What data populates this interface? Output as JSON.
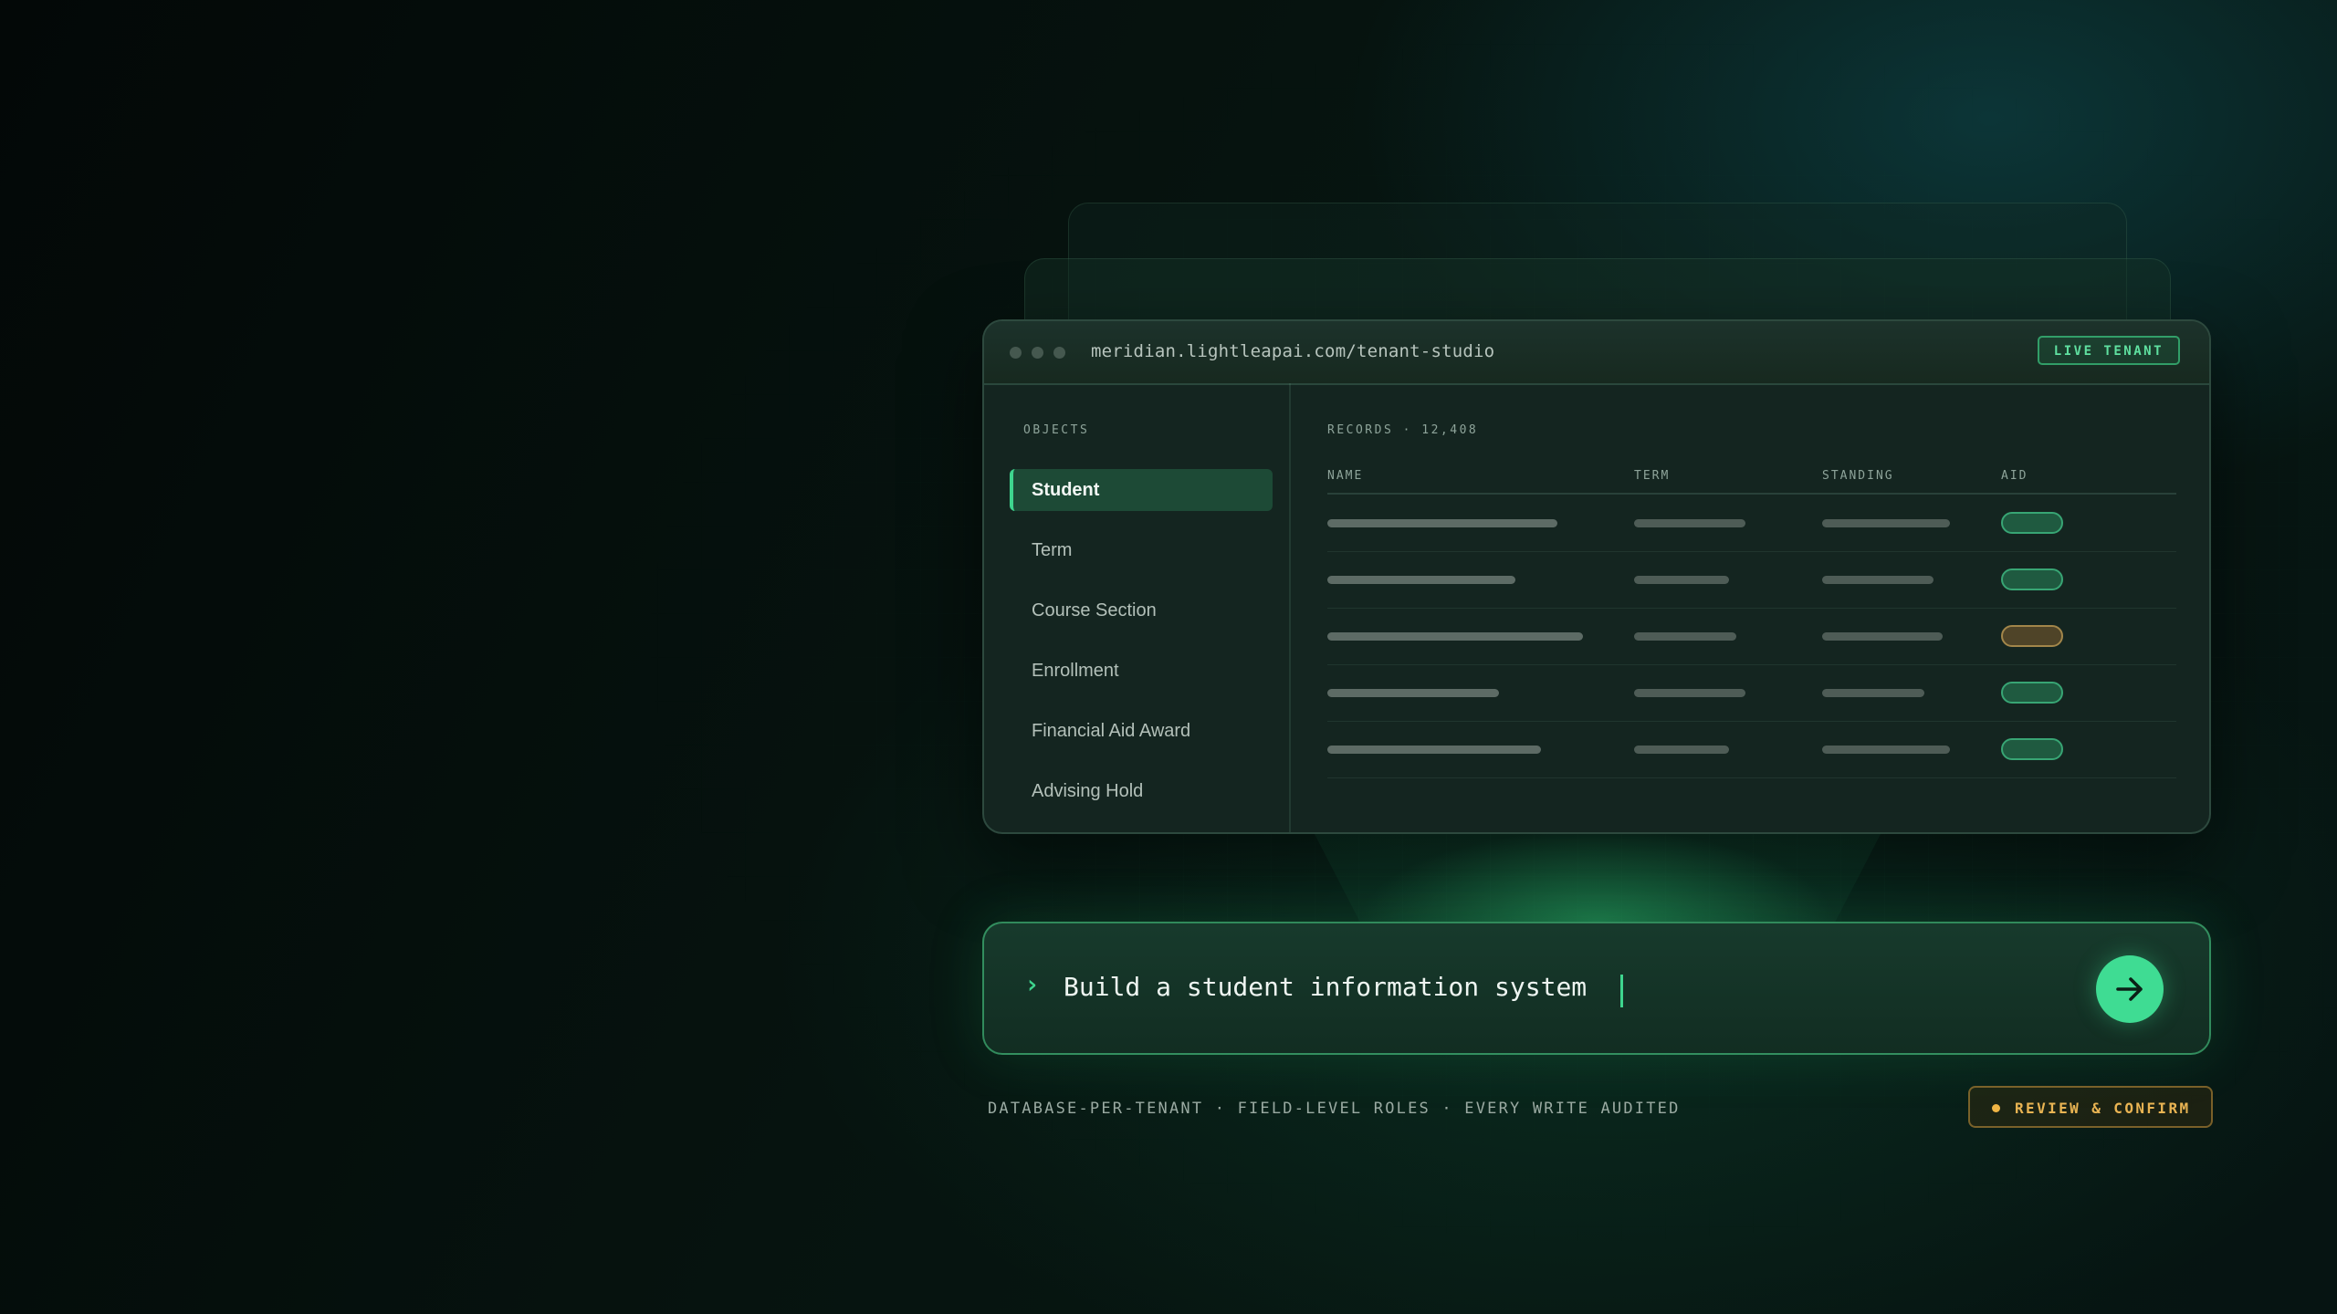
{
  "window": {
    "url": "meridian.lightleapai.com/tenant-studio",
    "live_badge": "LIVE TENANT"
  },
  "sidebar": {
    "section_label": "OBJECTS",
    "items": [
      {
        "label": "Student",
        "active": true
      },
      {
        "label": "Term"
      },
      {
        "label": "Course Section"
      },
      {
        "label": "Enrollment"
      },
      {
        "label": "Financial Aid Award"
      },
      {
        "label": "Advising Hold"
      }
    ]
  },
  "records": {
    "section_label": "RECORDS · 12,408",
    "columns": [
      "NAME",
      "TERM",
      "STANDING",
      "AID"
    ],
    "rows": [
      {
        "aid_status": "green"
      },
      {
        "aid_status": "green"
      },
      {
        "aid_status": "amber"
      },
      {
        "aid_status": "green"
      },
      {
        "aid_status": "green"
      }
    ]
  },
  "prompt": {
    "text": "Build a student information system",
    "chevron": "›",
    "send_icon": "arrow-right-icon"
  },
  "footer": {
    "tagline": "DATABASE-PER-TENANT · FIELD-LEVEL ROLES · EVERY WRITE AUDITED",
    "review_badge": "REVIEW & CONFIRM"
  },
  "colors": {
    "accent": "#3fdc93",
    "warning": "#e9b453",
    "background": "#06130f"
  }
}
